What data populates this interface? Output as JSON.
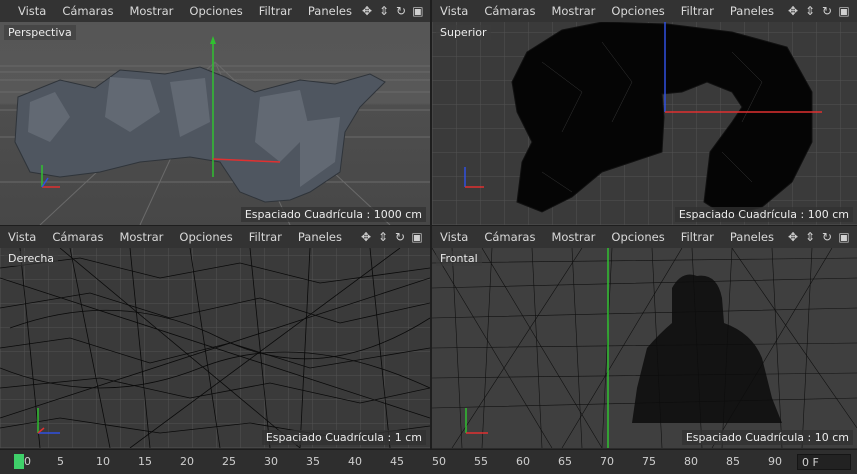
{
  "menu": [
    "Vista",
    "Cámaras",
    "Mostrar",
    "Opciones",
    "Filtrar",
    "Paneles"
  ],
  "nav_icons": [
    "move-icon",
    "zoom-icon",
    "rotate-icon",
    "maximize-icon"
  ],
  "viewports": {
    "perspective": {
      "label": "Perspectiva",
      "grid_spacing": "Espaciado Cuadrícula : 1000 cm"
    },
    "top": {
      "label": "Superior",
      "grid_spacing": "Espaciado Cuadrícula : 100 cm"
    },
    "right": {
      "label": "Derecha",
      "grid_spacing": "Espaciado Cuadrícula : 1 cm"
    },
    "front": {
      "label": "Frontal",
      "grid_spacing": "Espaciado Cuadrícula : 10 cm"
    }
  },
  "timeline": {
    "ticks": [
      "0",
      "5",
      "10",
      "15",
      "20",
      "25",
      "30",
      "35",
      "40",
      "45",
      "50",
      "55",
      "60",
      "65",
      "70",
      "75",
      "80",
      "85",
      "90"
    ],
    "current_frame": "0 F"
  },
  "colors": {
    "axis_x": "#e03030",
    "axis_y": "#30c030",
    "axis_z": "#3050e0",
    "cursor": "#3fd06a"
  }
}
